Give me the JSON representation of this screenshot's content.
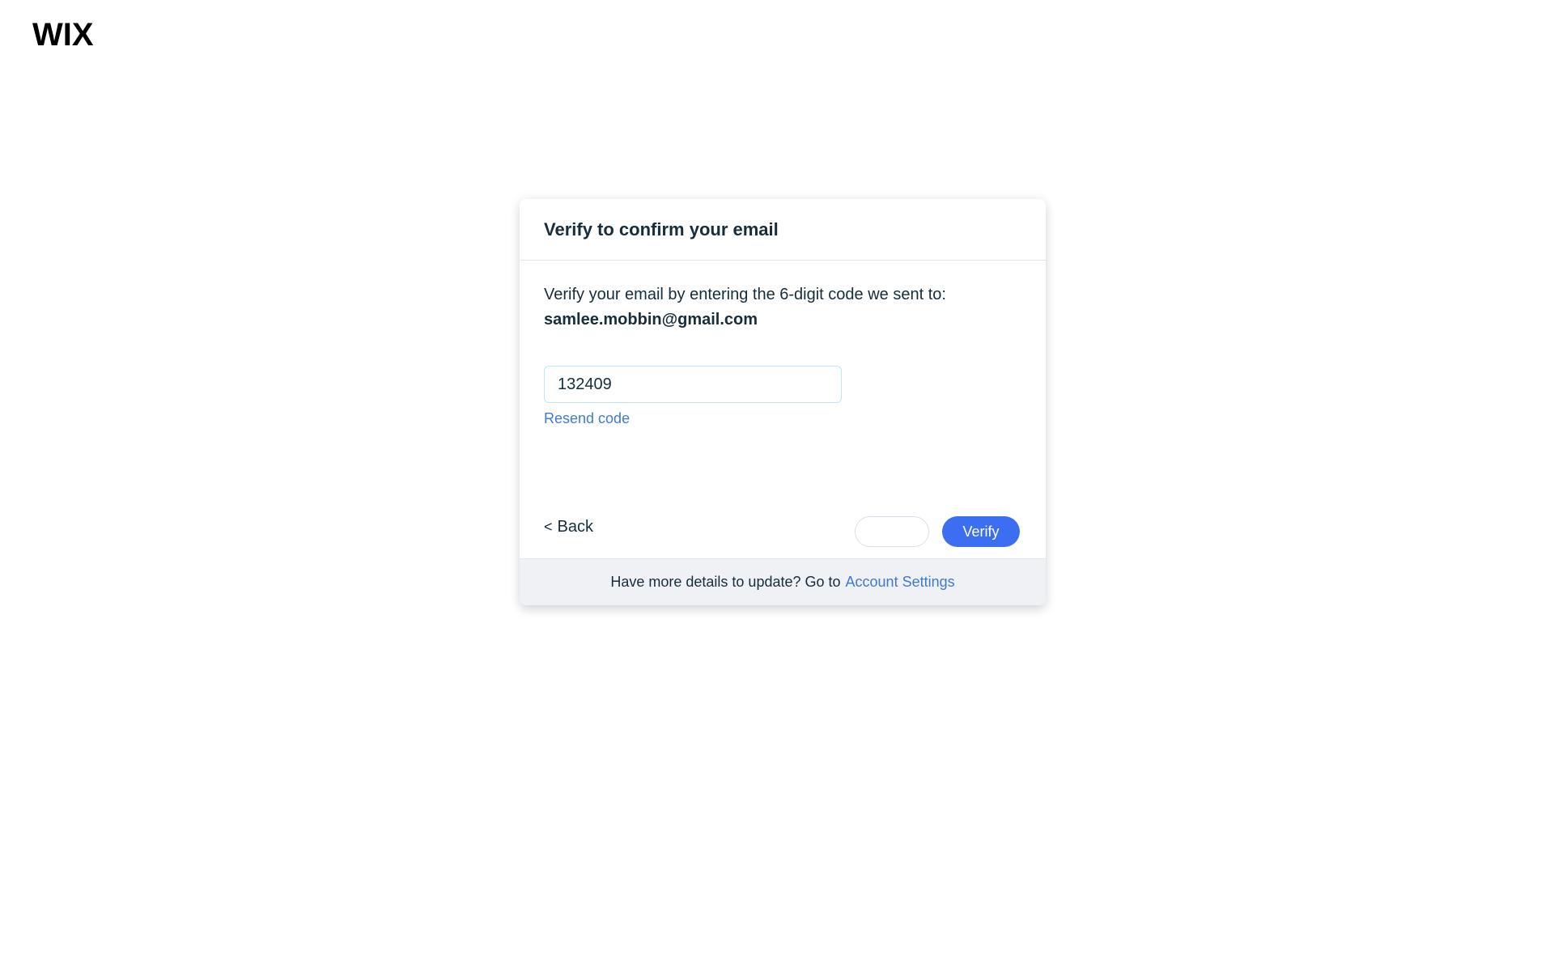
{
  "brand": {
    "logo_text": "WIX"
  },
  "dialog": {
    "title": "Verify to confirm your email",
    "description": "Verify your email by entering the 6-digit code we sent to:",
    "email": "samlee.mobbin@gmail.com",
    "code_value": "132409",
    "resend_label": "Resend code",
    "back_label": "Back",
    "back_icon": "chevron-left-icon",
    "secondary_button_label": "",
    "verify_label": "Verify"
  },
  "footer": {
    "text": "Have more details to update? Go to",
    "link_label": "Account Settings"
  },
  "colors": {
    "primary": "#3b6ef0",
    "link": "#3f79d8",
    "text": "#162d3d",
    "footer_bg": "#eff1f4"
  }
}
